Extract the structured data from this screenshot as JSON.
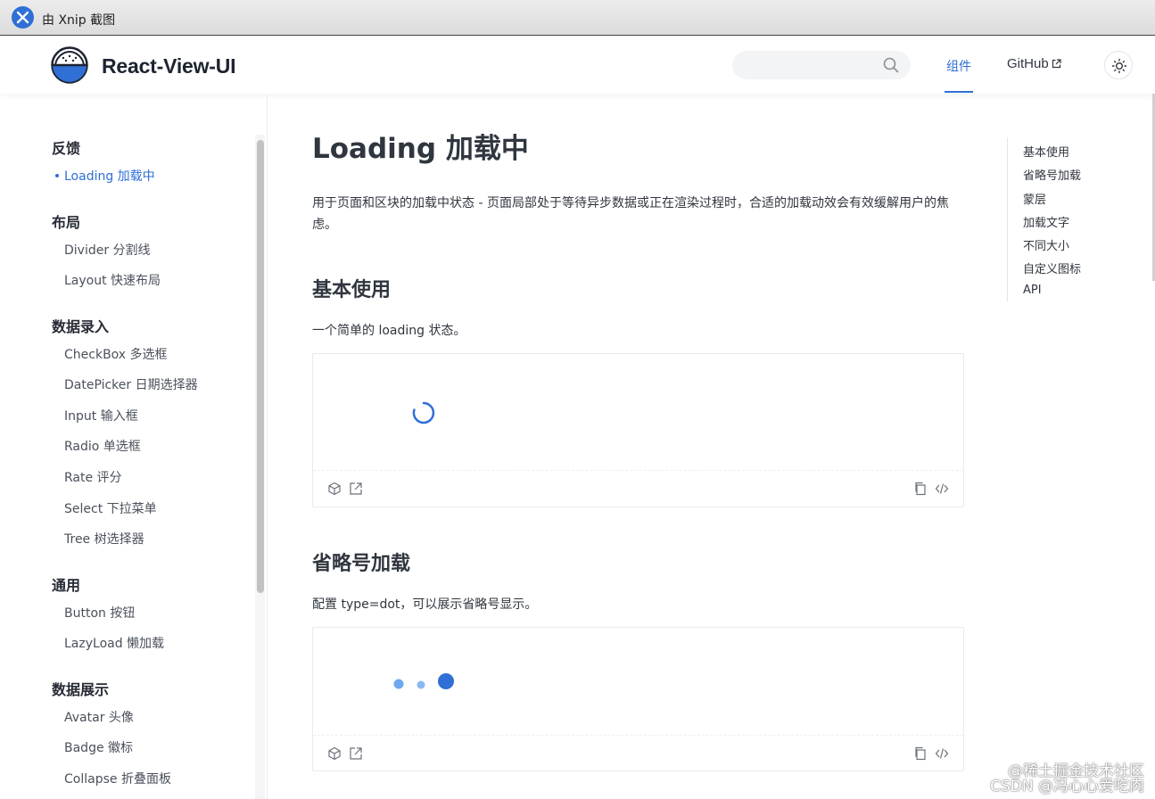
{
  "window": {
    "title": "由 Xnip 截图"
  },
  "header": {
    "brand": "React-View-UI",
    "search_placeholder": "",
    "nav": {
      "components": "组件",
      "github": "GitHub"
    }
  },
  "sidebar": {
    "groups": [
      {
        "label": "反馈",
        "items": [
          "Loading 加载中"
        ]
      },
      {
        "label": "布局",
        "items": [
          "Divider 分割线",
          "Layout 快速布局"
        ]
      },
      {
        "label": "数据录入",
        "items": [
          "CheckBox 多选框",
          "DatePicker 日期选择器",
          "Input 输入框",
          "Radio 单选框",
          "Rate 评分",
          "Select 下拉菜单",
          "Tree 树选择器"
        ]
      },
      {
        "label": "通用",
        "items": [
          "Button 按钮",
          "LazyLoad 懒加载"
        ]
      },
      {
        "label": "数据展示",
        "items": [
          "Avatar 头像",
          "Badge 徽标",
          "Collapse 折叠面板"
        ]
      }
    ],
    "active_item": "Loading 加载中"
  },
  "main": {
    "title": "Loading 加载中",
    "description": "用于页面和区块的加载中状态 - 页面局部处于等待异步数据或正在渲染过程时，合适的加载动效会有效缓解用户的焦虑。",
    "sections": [
      {
        "heading": "基本使用",
        "text": "一个简单的 loading 状态。"
      },
      {
        "heading": "省略号加载",
        "text": "配置 type=dot，可以展示省略号显示。"
      }
    ]
  },
  "toc": [
    "基本使用",
    "省略号加载",
    "蒙层",
    "加载文字",
    "不同大小",
    "自定义图标",
    "API"
  ],
  "watermark": {
    "line1": "@稀土掘金技术社区",
    "line2": "CSDN @冯心心爱吃肉"
  },
  "colors": {
    "accent": "#2f6fd6",
    "dot_light": "#6ea8ee",
    "text": "#30363f"
  }
}
